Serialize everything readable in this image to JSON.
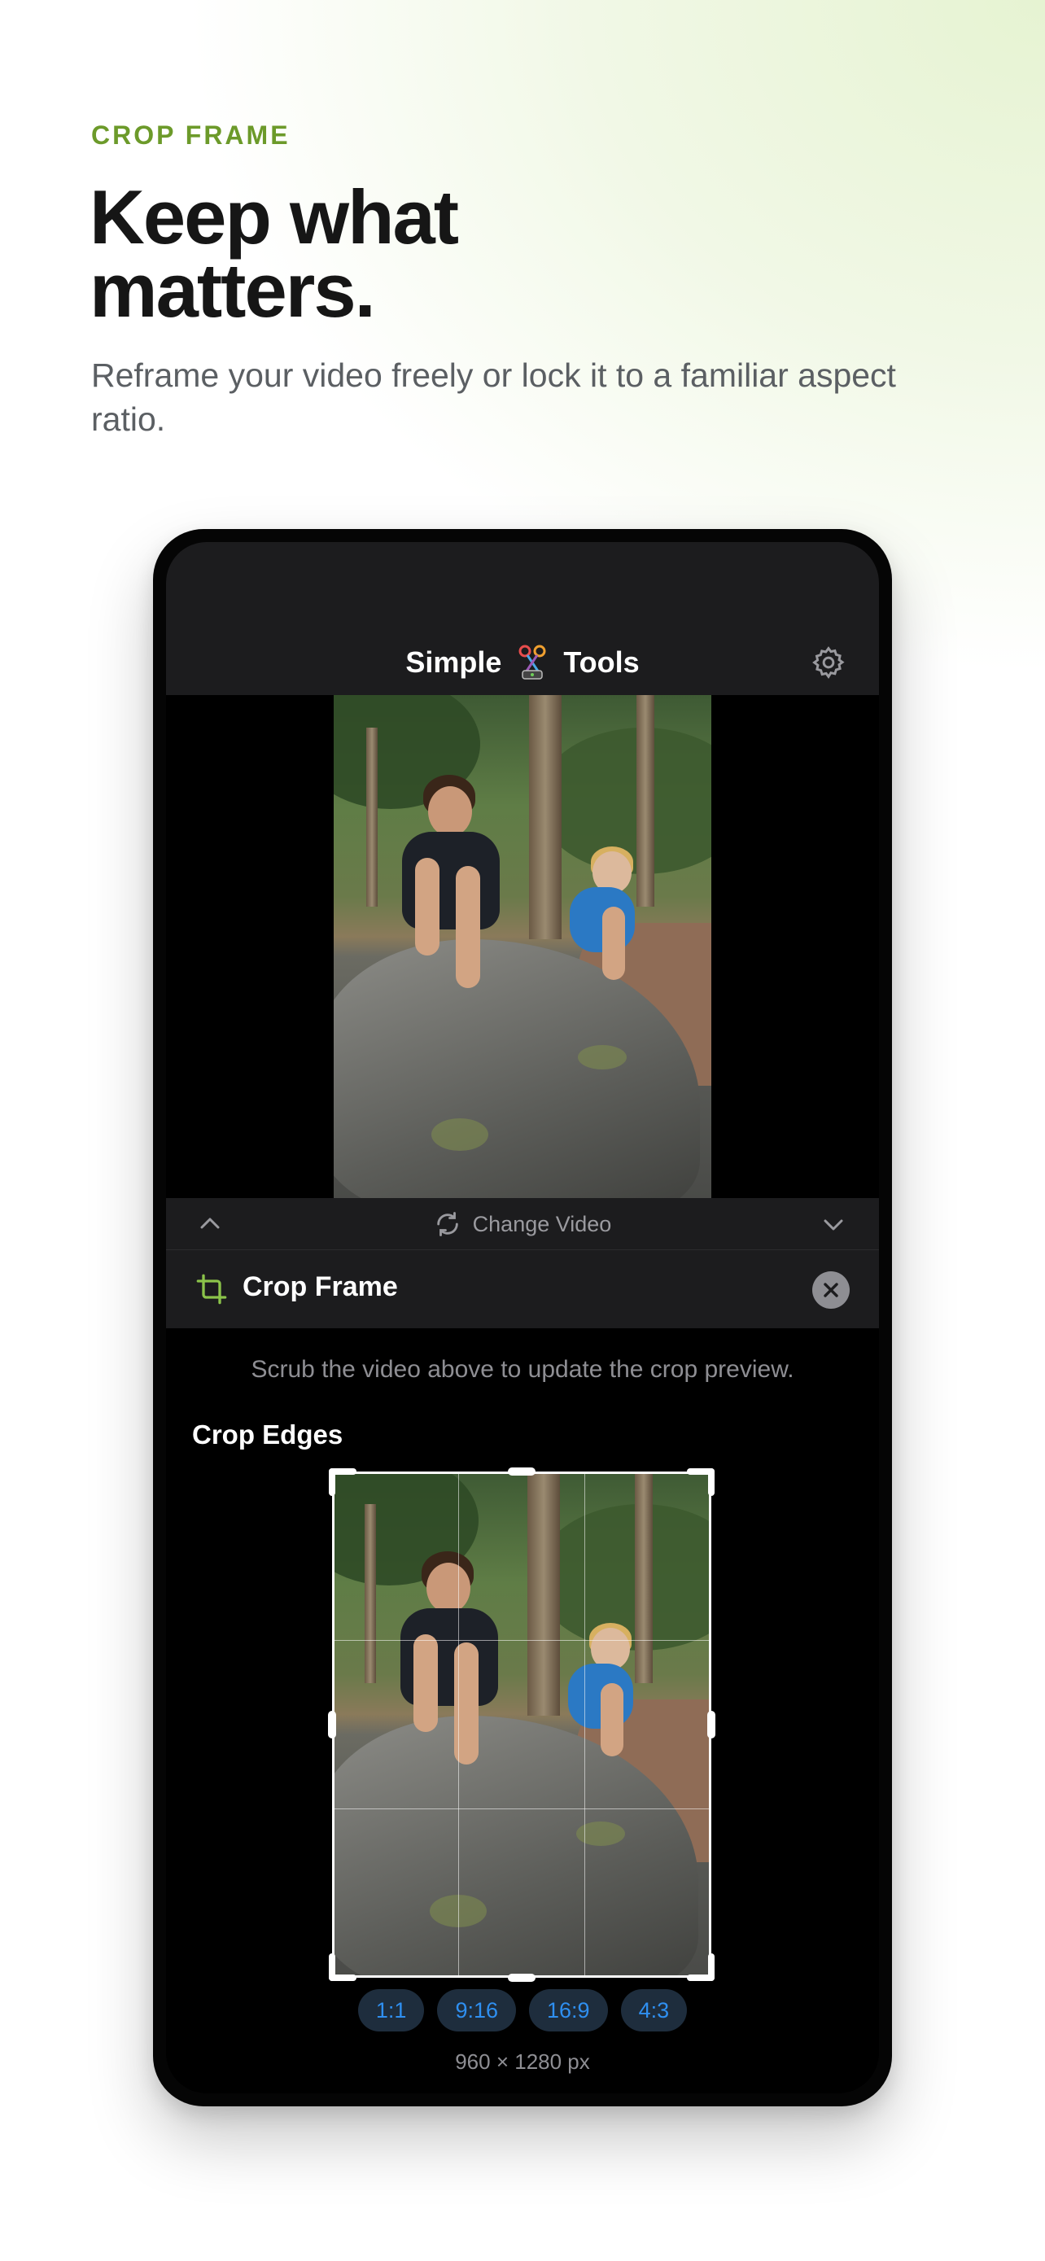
{
  "header": {
    "eyebrow": "CROP FRAME",
    "headline": "Keep what matters.",
    "subhead": "Reframe your video freely or lock it to a familiar aspect ratio."
  },
  "app": {
    "title_left": "Simple",
    "title_right": "Tools",
    "change_video_label": "Change Video",
    "panel_title": "Crop Frame",
    "hint": "Scrub the video above to update the crop preview.",
    "section_label": "Crop Edges",
    "ratios": [
      "1:1",
      "9:16",
      "16:9",
      "4:3"
    ],
    "dimensions": "960 × 1280 px"
  },
  "colors": {
    "accent_green": "#6c9a2a",
    "crop_icon": "#8bc34a",
    "chip_text": "#2f8ff0"
  }
}
